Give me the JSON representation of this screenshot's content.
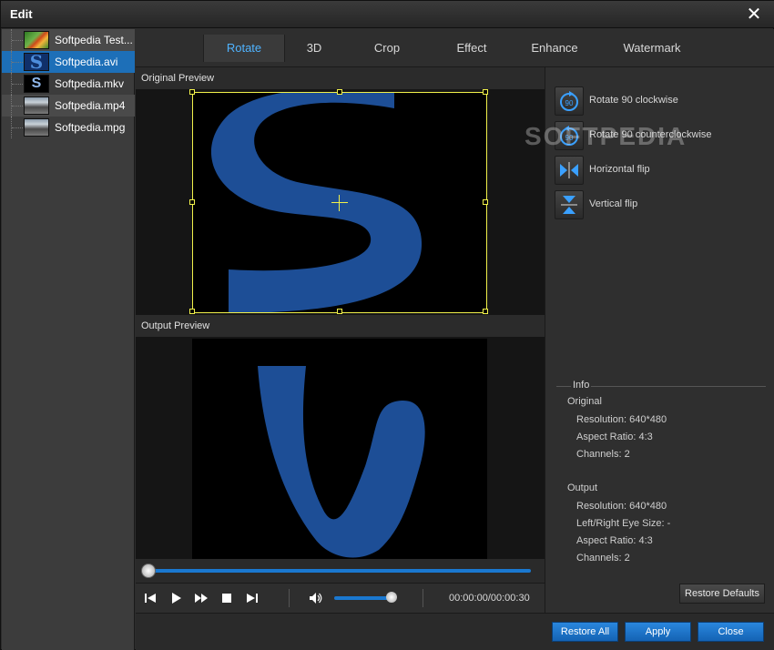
{
  "window": {
    "title": "Edit"
  },
  "files": [
    {
      "name": "Softpedia Test...",
      "thumb": "flower"
    },
    {
      "name": "Softpedia.avi",
      "thumb": "s-logo"
    },
    {
      "name": "Softpedia.mkv",
      "thumb": "mkv"
    },
    {
      "name": "Softpedia.mp4",
      "thumb": "street"
    },
    {
      "name": "Softpedia.mpg",
      "thumb": "street"
    }
  ],
  "selected_file_index": 1,
  "tabs": [
    "Rotate",
    "3D",
    "Crop",
    "Effect",
    "Enhance",
    "Watermark"
  ],
  "active_tab": "Rotate",
  "preview": {
    "original_label": "Original Preview",
    "output_label": "Output Preview",
    "logo_color": "#1d4e96"
  },
  "player": {
    "timecode": "00:00:00/00:00:30",
    "seek_fraction": 0.0,
    "volume_fraction": 0.95
  },
  "actions": [
    {
      "label": "Rotate 90 clockwise",
      "icon": "rotate-cw-icon"
    },
    {
      "label": "Rotate 90 counterclockwise",
      "icon": "rotate-ccw-icon"
    },
    {
      "label": "Horizontal flip",
      "icon": "flip-horizontal-icon"
    },
    {
      "label": "Vertical flip",
      "icon": "flip-vertical-icon"
    }
  ],
  "watermark_text": "SOFTPEDIA",
  "info": {
    "title": "Info",
    "original_heading": "Original",
    "original": {
      "resolution": "Resolution: 640*480",
      "aspect": "Aspect Ratio: 4:3",
      "channels": "Channels: 2"
    },
    "output_heading": "Output",
    "output": {
      "resolution": "Resolution: 640*480",
      "eye_size": "Left/Right Eye Size: -",
      "aspect": "Aspect Ratio: 4:3",
      "channels": "Channels: 2"
    }
  },
  "buttons": {
    "restore_defaults": "Restore Defaults",
    "restore_all": "Restore All",
    "apply": "Apply",
    "close": "Close"
  },
  "colors": {
    "accent": "#1a78d0",
    "tab_active": "#4fb3ff",
    "crop": "#f1f14a"
  }
}
